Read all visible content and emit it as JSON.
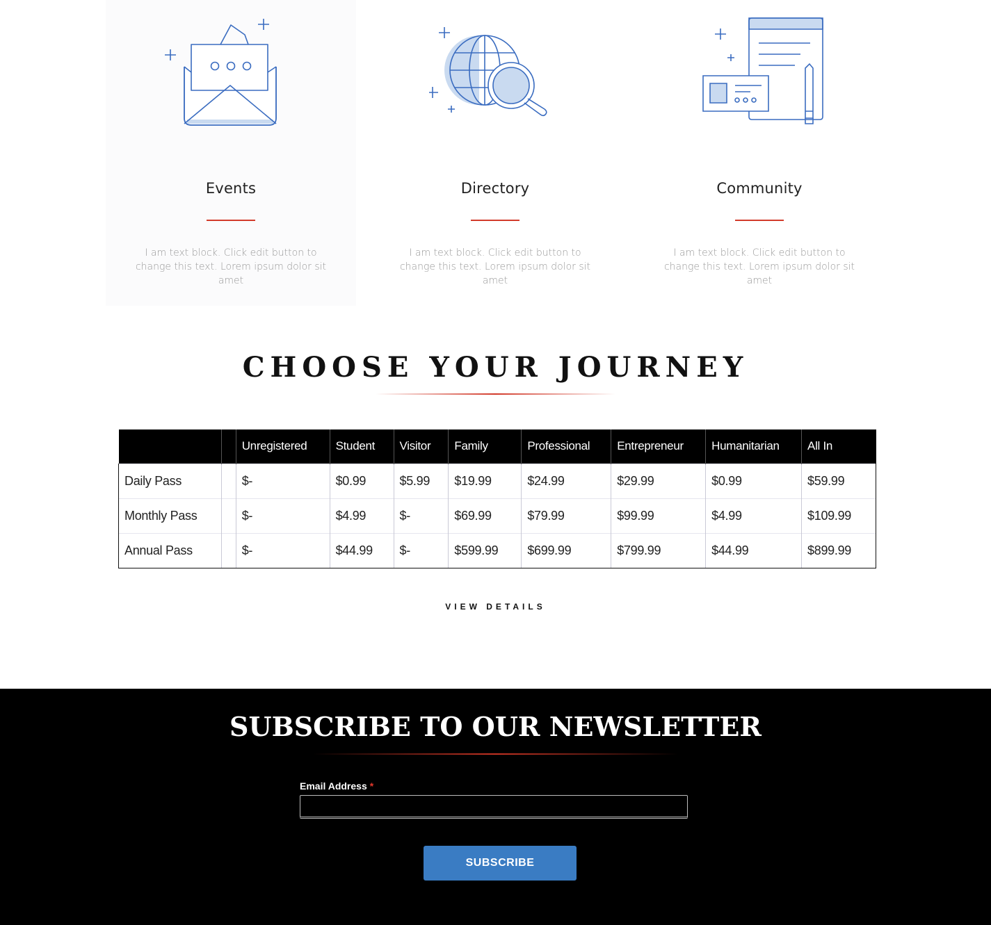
{
  "features": [
    {
      "title": "Events",
      "text": "I am text block. Click edit button to change this text. Lorem ipsum dolor sit amet",
      "icon": "envelope-icon"
    },
    {
      "title": "Directory",
      "text": "I am text block. Click edit button to change this text. Lorem ipsum dolor sit amet",
      "icon": "globe-search-icon"
    },
    {
      "title": "Community",
      "text": "I am text block. Click edit button to change this text. Lorem ipsum dolor sit amet",
      "icon": "id-card-document-icon"
    }
  ],
  "journey": {
    "title": "CHOOSE YOUR JOURNEY",
    "columns": [
      "",
      "",
      "Unregistered",
      "Student",
      "Visitor",
      "Family",
      "Professional",
      "Entrepreneur",
      "Humanitarian",
      "All In"
    ],
    "rows": [
      [
        "Daily Pass",
        "",
        "$-",
        "$0.99",
        "$5.99",
        "$19.99",
        "$24.99",
        "$29.99",
        "$0.99",
        "$59.99"
      ],
      [
        "Monthly Pass",
        "",
        "$-",
        "$4.99",
        "$-",
        "$69.99",
        "$79.99",
        "$99.99",
        "$4.99",
        "$109.99"
      ],
      [
        "Annual Pass",
        "",
        "$-",
        "$44.99",
        "$-",
        "$599.99",
        "$699.99",
        "$799.99",
        "$44.99",
        "$899.99"
      ]
    ],
    "view_details": "VIEW DETAILS"
  },
  "newsletter": {
    "title": "SUBSCRIBE TO OUR NEWSLETTER",
    "email_label": "Email Address",
    "required_mark": "*",
    "email_value": "",
    "subscribe_label": "SUBSCRIBE"
  },
  "colors": {
    "accent_red": "#d23a2a",
    "icon_blue": "#3a6cc0",
    "icon_fill": "#c9daf0",
    "button_blue": "#3a7cc3"
  }
}
